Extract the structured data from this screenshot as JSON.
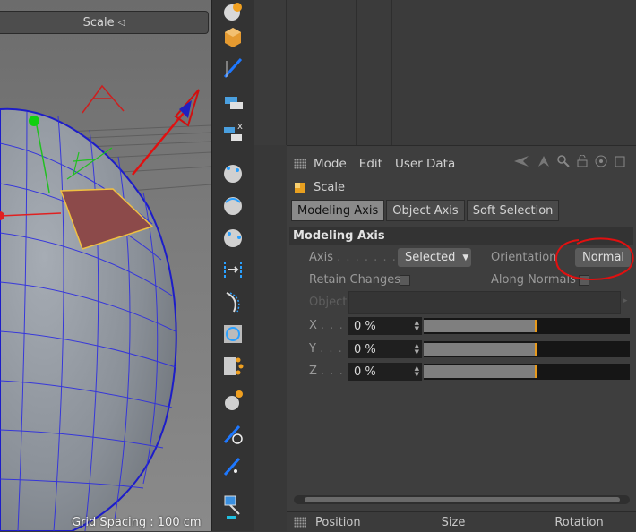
{
  "viewport": {
    "header_label": "Scale",
    "grid_spacing": "Grid Spacing : 100 cm"
  },
  "toolbar": {
    "tools": [
      "sphere-tool-icon",
      "cube-tool-icon",
      "knife-icon",
      "extrude-icon",
      "bridge-icon",
      "point-select-icon",
      "edge-select-icon",
      "poly-select-icon",
      "align-icon",
      "bevel-icon",
      "weld-icon",
      "subdivide-icon",
      "magnet-icon",
      "brush-icon",
      "paint-icon",
      "axis-tool-icon"
    ]
  },
  "attributes": {
    "menu": [
      "Mode",
      "Edit",
      "User Data"
    ],
    "title": "Scale",
    "tabs": [
      {
        "label": "Modeling Axis",
        "active": true
      },
      {
        "label": "Object Axis",
        "active": false
      },
      {
        "label": "Soft Selection",
        "active": false
      }
    ],
    "section_title": "Modeling Axis",
    "axis_label": "Axis",
    "axis_value": "Selected",
    "orientation_label": "Orientation",
    "orientation_value": "Normal",
    "retain_label": "Retain Changes",
    "along_normals_label": "Along Normals",
    "object_label": "Object",
    "coords": [
      {
        "label": "X",
        "value": "0 %",
        "slider_fraction": 0.5
      },
      {
        "label": "Y",
        "value": "0 %",
        "slider_fraction": 0.5
      },
      {
        "label": "Z",
        "value": "0 %",
        "slider_fraction": 0.5
      }
    ]
  },
  "bottom": {
    "position": "Position",
    "size": "Size",
    "rotation": "Rotation"
  },
  "colors": {
    "accent": "#e89a1c",
    "annotation": "#e01010",
    "selected_poly": "#8c4a4a",
    "mesh_wire": "#2f2fd0"
  }
}
